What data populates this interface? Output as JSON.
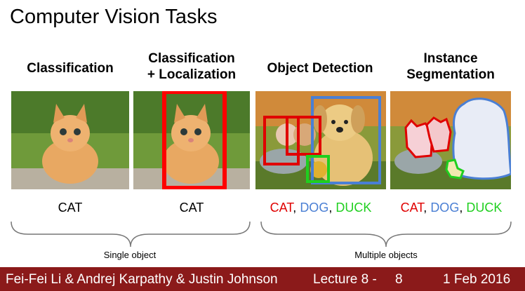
{
  "slide": {
    "title": "Computer Vision Tasks",
    "columns": [
      {
        "heading_1": "Classification",
        "heading_2": "",
        "label": "CAT"
      },
      {
        "heading_1": "Classification",
        "heading_2": "+ Localization",
        "label": "CAT"
      },
      {
        "heading_1": "Object Detection",
        "heading_2": ""
      },
      {
        "heading_1": "Instance",
        "heading_2": "Segmentation"
      }
    ],
    "multi_label": {
      "cat": "CAT",
      "comma1": ", ",
      "dog": "DOG",
      "comma2": ", ",
      "duck": "DUCK"
    },
    "groups": {
      "single": "Single object",
      "multiple": "Multiple objects"
    },
    "colors": {
      "cat": "#e00000",
      "dog": "#4a7fd4",
      "duck": "#1fcf1f",
      "footer": "#8b1a1a"
    }
  },
  "footer": {
    "authors": "Fei-Fei Li & Andrej Karpathy & Justin Johnson",
    "lecture": "Lecture 8 -",
    "page": "8",
    "date": "1 Feb 2016"
  }
}
